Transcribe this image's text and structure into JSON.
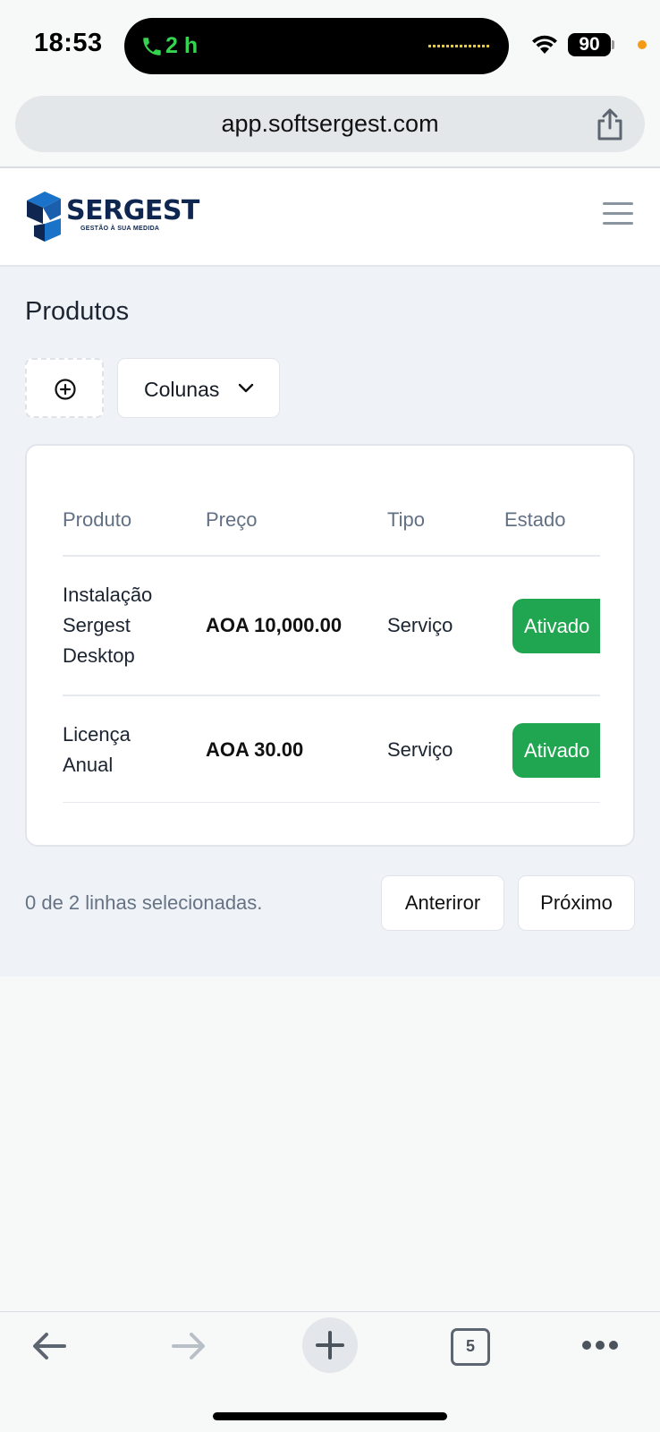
{
  "status_bar": {
    "time": "18:53",
    "call_duration": "2 h",
    "battery": "90",
    "icons": [
      "phone-icon",
      "wifi-icon",
      "battery-icon"
    ]
  },
  "browser": {
    "url": "app.softsergest.com",
    "tab_count": "5",
    "icons": [
      "share-icon",
      "back-icon",
      "forward-icon",
      "plus-icon",
      "tabs-icon",
      "more-icon"
    ]
  },
  "header": {
    "logo_name": "SERGEST",
    "logo_tagline": "GESTÃO À SUA MEDIDA",
    "menu_icon": "hamburger-menu-icon"
  },
  "page": {
    "title": "Produtos",
    "columns_button": "Colunas"
  },
  "table": {
    "headers": [
      "Produto",
      "Preço",
      "Tipo",
      "Estado"
    ],
    "rows": [
      {
        "produto": "Instalação Sergest Desktop",
        "preco": "AOA 10,000.00",
        "tipo": "Serviço",
        "estado": "Ativado"
      },
      {
        "produto": "Licença Anual",
        "preco": "AOA 30.00",
        "tipo": "Serviço",
        "estado": "Ativado"
      }
    ]
  },
  "footer": {
    "selection": "0 de 2 linhas selecionadas.",
    "prev": "Anteriror",
    "next": "Próximo"
  },
  "colors": {
    "accent_green": "#20a650",
    "brand_navy": "#0e2650",
    "brand_blue": "#1a73c8",
    "call_green": "#35d34f"
  }
}
